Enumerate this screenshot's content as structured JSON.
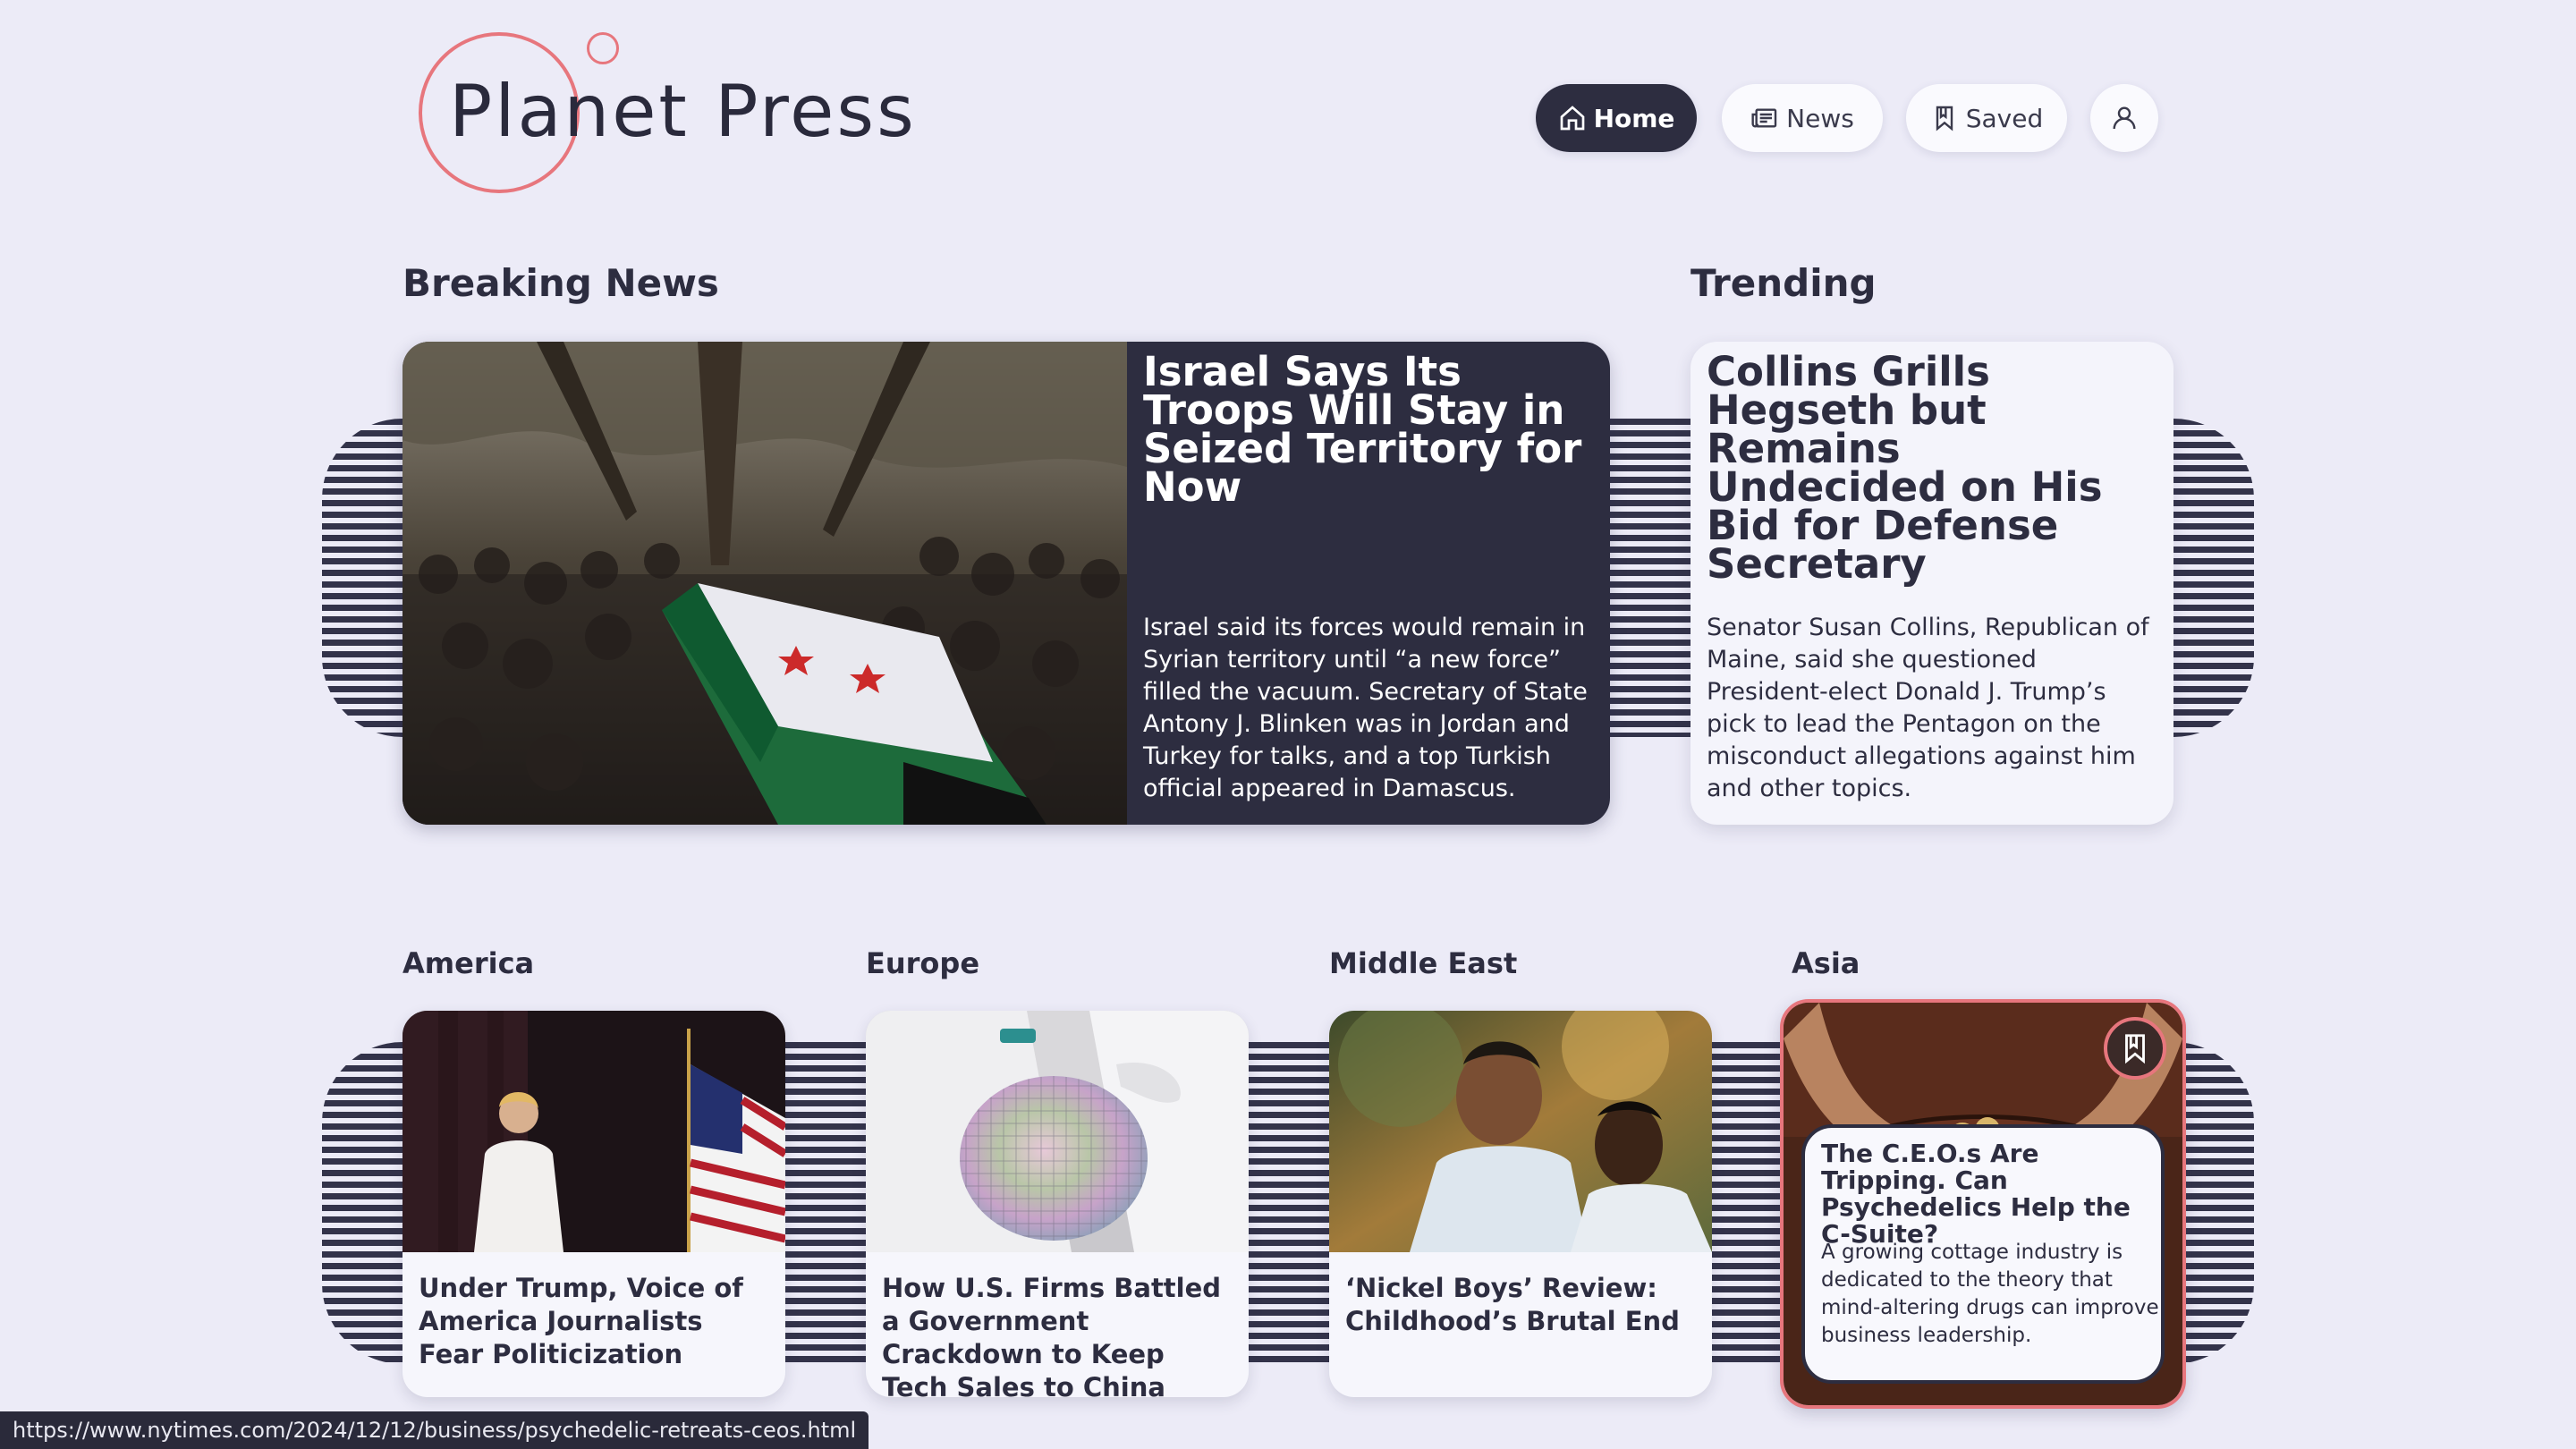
{
  "brand": {
    "name": "Planet Press",
    "accent": "#e7767d",
    "dark": "#2d2d40",
    "background": "#ecebf7"
  },
  "nav": {
    "items": [
      {
        "label": "Home",
        "icon": "home-icon",
        "active": true
      },
      {
        "label": "News",
        "icon": "newspaper-icon",
        "active": false
      },
      {
        "label": "Saved",
        "icon": "bookmark-icon",
        "active": false
      }
    ],
    "profile_icon": "user-icon"
  },
  "breaking": {
    "heading": "Breaking News",
    "headline": "Israel Says Its Troops Will Stay in Seized Territory for Now",
    "summary": "Israel said its forces would remain in Syrian territory until “a new force” filled the vacuum. Secretary of State Antony J. Blinken was in Jordan and Turkey for talks, and a top Turkish official appeared in Damascus."
  },
  "trending": {
    "heading": "Trending",
    "headline": "Collins Grills Hegseth but Remains Undecided on His Bid for Defense Secretary",
    "summary": "Senator Susan Collins, Republican of Maine, said she questioned President-elect Donald J. Trump’s pick to lead the Pentagon on the misconduct allegations against him and other topics."
  },
  "regions": [
    {
      "name": "America",
      "title": "Under Trump, Voice of America Journalists Fear Politicization"
    },
    {
      "name": "Europe",
      "title": "How U.S. Firms Battled a Government Crackdown to Keep Tech Sales to China"
    },
    {
      "name": "Middle East",
      "title": "‘Nickel Boys’ Review: Childhood’s Brutal End"
    },
    {
      "name": "Asia",
      "title": "The C.E.O.s Are Tripping. Can Psychedelics Help the C-Suite?",
      "summary": "A growing cottage industry is dedicated to the theory that mind-altering drugs can improve business leadership.",
      "bookmark_icon": "bookmark-icon"
    }
  ],
  "status_url": "https://www.nytimes.com/2024/12/12/business/psychedelic-retreats-ceos.html"
}
